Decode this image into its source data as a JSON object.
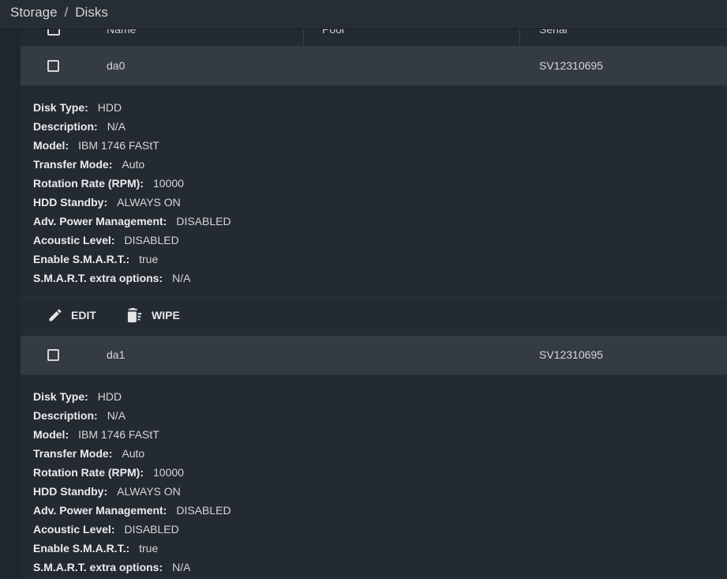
{
  "breadcrumb": {
    "root": "Storage",
    "separator": "/",
    "current": "Disks"
  },
  "table": {
    "columns": [
      "Name",
      "Pool",
      "Serial"
    ]
  },
  "detail_labels": {
    "disk_type": "Disk Type:",
    "description": "Description:",
    "model": "Model:",
    "transfer_mode": "Transfer Mode:",
    "rotation_rate": "Rotation Rate (RPM):",
    "hdd_standby": "HDD Standby:",
    "adv_power": "Adv. Power Management:",
    "acoustic": "Acoustic Level:",
    "smart_enable": "Enable S.M.A.R.T.:",
    "smart_extra": "S.M.A.R.T. extra options:"
  },
  "actions": {
    "edit": "EDIT",
    "wipe": "WIPE"
  },
  "disks": [
    {
      "name": "da0",
      "pool": "",
      "serial": "SV12310695",
      "disk_type": "HDD",
      "description": "N/A",
      "model": "IBM 1746 FAStT",
      "transfer_mode": "Auto",
      "rotation_rate": "10000",
      "hdd_standby": "ALWAYS ON",
      "adv_power": "DISABLED",
      "acoustic": "DISABLED",
      "smart_enable": "true",
      "smart_extra": "N/A"
    },
    {
      "name": "da1",
      "pool": "",
      "serial": "SV12310695",
      "disk_type": "HDD",
      "description": "N/A",
      "model": "IBM 1746 FAStT",
      "transfer_mode": "Auto",
      "rotation_rate": "10000",
      "hdd_standby": "ALWAYS ON",
      "adv_power": "DISABLED",
      "acoustic": "DISABLED",
      "smart_enable": "true",
      "smart_extra": "N/A"
    }
  ]
}
